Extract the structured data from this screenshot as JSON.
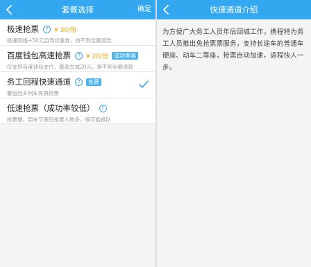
{
  "left": {
    "title": "套餐选择",
    "confirm": "确定",
    "items": [
      {
        "title": "极速抢票",
        "price": "¥ 30/份",
        "desc": "极速网络+50元自驾优惠券，抢不到全额退款"
      },
      {
        "title": "百度钱包高速抢票",
        "price": "¥ 20/份",
        "badge": "成功率高",
        "desc": "仅支持百度钱包支付，最高立减20元，抢不到全额退款"
      },
      {
        "title": "务工回程快速通道",
        "badge": "免费",
        "desc": "春运回乡列车免费抢票",
        "selected": true
      },
      {
        "title": "低速抢票（成功率较低）",
        "desc": "抢票慢，周末节假日抢票人数多，很可能排队"
      }
    ]
  },
  "right": {
    "title": "快速通道介绍",
    "text": "为方便广大务工人员年后回城工作，携程特为务工人员推出免抢票票服务，支持长途车的普通车硬座、动车二等座，抢票自动加速，返程快人一步。"
  },
  "icons": {
    "back": "chevron-left-icon",
    "help": "question-circle-icon",
    "check": "checkmark-icon"
  },
  "colors": {
    "navbar": "#33a8f0",
    "price": "#e8a100",
    "badge": "#48b2ef",
    "check": "#3aa0e6"
  }
}
